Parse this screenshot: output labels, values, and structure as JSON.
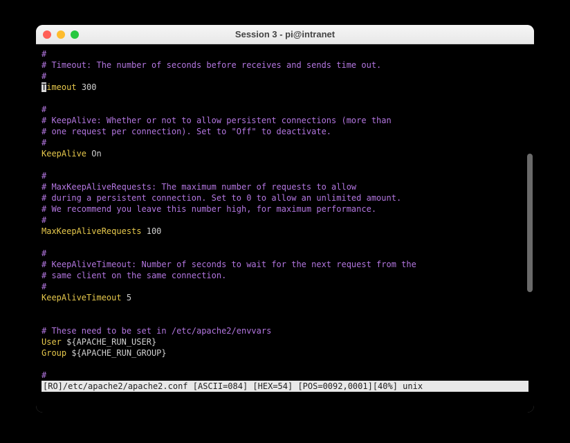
{
  "window": {
    "title": "Session 3 - pi@intranet"
  },
  "editor": {
    "lines": [
      {
        "type": "comment",
        "text": "#"
      },
      {
        "type": "comment",
        "text": "# Timeout: The number of seconds before receives and sends time out."
      },
      {
        "type": "comment",
        "text": "#"
      },
      {
        "type": "directive-cursor",
        "cursor_char": "T",
        "rest_directive": "imeout",
        "value": " 300"
      },
      {
        "type": "blank",
        "text": ""
      },
      {
        "type": "comment",
        "text": "#"
      },
      {
        "type": "comment",
        "text": "# KeepAlive: Whether or not to allow persistent connections (more than"
      },
      {
        "type": "comment",
        "text": "# one request per connection). Set to \"Off\" to deactivate."
      },
      {
        "type": "comment",
        "text": "#"
      },
      {
        "type": "directive",
        "directive": "KeepAlive",
        "value": " On"
      },
      {
        "type": "blank",
        "text": ""
      },
      {
        "type": "comment",
        "text": "#"
      },
      {
        "type": "comment",
        "text": "# MaxKeepAliveRequests: The maximum number of requests to allow"
      },
      {
        "type": "comment",
        "text": "# during a persistent connection. Set to 0 to allow an unlimited amount."
      },
      {
        "type": "comment",
        "text": "# We recommend you leave this number high, for maximum performance."
      },
      {
        "type": "comment",
        "text": "#"
      },
      {
        "type": "directive",
        "directive": "MaxKeepAliveRequests",
        "value": " 100"
      },
      {
        "type": "blank",
        "text": ""
      },
      {
        "type": "comment",
        "text": "#"
      },
      {
        "type": "comment",
        "text": "# KeepAliveTimeout: Number of seconds to wait for the next request from the"
      },
      {
        "type": "comment",
        "text": "# same client on the same connection."
      },
      {
        "type": "comment",
        "text": "#"
      },
      {
        "type": "directive",
        "directive": "KeepAliveTimeout",
        "value": " 5"
      },
      {
        "type": "blank",
        "text": ""
      },
      {
        "type": "blank",
        "text": ""
      },
      {
        "type": "comment",
        "text": "# These need to be set in /etc/apache2/envvars"
      },
      {
        "type": "directive-var",
        "directive": "User",
        "var": " ${APACHE_RUN_USER}"
      },
      {
        "type": "directive-var",
        "directive": "Group",
        "var": " ${APACHE_RUN_GROUP}"
      },
      {
        "type": "blank",
        "text": ""
      },
      {
        "type": "comment",
        "text": "#"
      }
    ],
    "status": "[RO]/etc/apache2/apache2.conf [ASCII=084] [HEX=54] [POS=0092,0001][40%] unix"
  }
}
